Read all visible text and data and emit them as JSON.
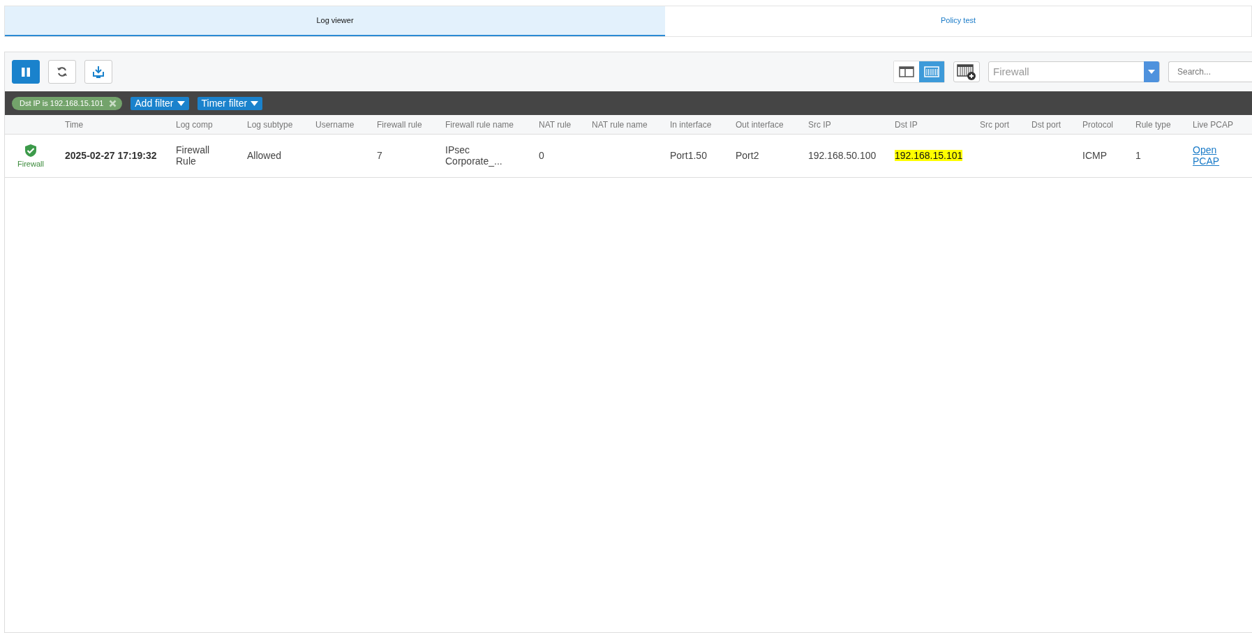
{
  "tabs": [
    {
      "label": "Log viewer",
      "selected": true
    },
    {
      "label": "Policy test",
      "selected": false
    }
  ],
  "toolbar": {
    "pause": {
      "pressed": true
    },
    "view_modes": [
      {
        "kind": "panes",
        "selected": false
      },
      {
        "kind": "columns",
        "selected": true
      }
    ],
    "log_type": {
      "value": "Firewall"
    },
    "search": {
      "placeholder": "Search..."
    }
  },
  "filters": {
    "active": [
      {
        "label": "Dst IP is 192.168.15.101"
      }
    ],
    "menus": [
      "Add filter",
      "Timer filter"
    ]
  },
  "table": {
    "columns": [
      "",
      "Time",
      "Log comp",
      "Log subtype",
      "Username",
      "Firewall rule",
      "Firewall rule name",
      "NAT rule",
      "NAT rule name",
      "In interface",
      "Out interface",
      "Src IP",
      "Dst IP",
      "Src port",
      "Dst port",
      "Protocol",
      "Rule type",
      "Live PCAP"
    ],
    "rows": [
      {
        "cells": [
          {
            "kind": "status",
            "text": "Firewall"
          },
          {
            "kind": "bold",
            "text": "2025-02-27 17:19:32"
          },
          {
            "kind": "multiline",
            "text": "Firewall Rule"
          },
          {
            "kind": "text",
            "text": "Allowed"
          },
          {
            "kind": "empty"
          },
          {
            "kind": "text",
            "text": "7"
          },
          {
            "kind": "multiline",
            "text": "IPsec Corporate_..."
          },
          {
            "kind": "text",
            "text": "0"
          },
          {
            "kind": "empty"
          },
          {
            "kind": "text",
            "text": "Port1.50"
          },
          {
            "kind": "text",
            "text": "Port2"
          },
          {
            "kind": "text",
            "text": "192.168.50.100"
          },
          {
            "kind": "text",
            "text": "192.168.15.101",
            "highlighted": true
          },
          {
            "kind": "empty"
          },
          {
            "kind": "empty"
          },
          {
            "kind": "text",
            "text": "ICMP"
          },
          {
            "kind": "text",
            "text": "1"
          },
          {
            "kind": "link",
            "text": "Open PCAP"
          }
        ]
      }
    ]
  }
}
